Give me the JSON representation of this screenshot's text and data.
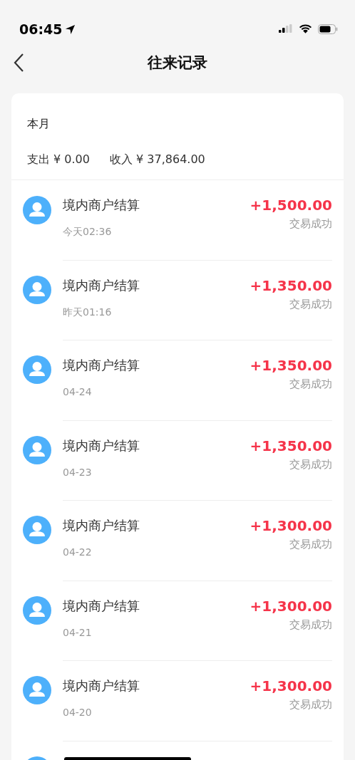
{
  "status_bar": {
    "time": "06:45"
  },
  "nav": {
    "title": "往来记录"
  },
  "summary": {
    "period": "本月",
    "expense": "支出 ¥ 0.00",
    "income": "收入 ¥ 37,864.00"
  },
  "records": [
    {
      "title": "境内商户结算",
      "time": "今天02:36",
      "amount": "+1,500.00",
      "status": "交易成功"
    },
    {
      "title": "境内商户结算",
      "time": "昨天01:16",
      "amount": "+1,350.00",
      "status": "交易成功"
    },
    {
      "title": "境内商户结算",
      "time": "04-24",
      "amount": "+1,350.00",
      "status": "交易成功"
    },
    {
      "title": "境内商户结算",
      "time": "04-23",
      "amount": "+1,350.00",
      "status": "交易成功"
    },
    {
      "title": "境内商户结算",
      "time": "04-22",
      "amount": "+1,300.00",
      "status": "交易成功"
    },
    {
      "title": "境内商户结算",
      "time": "04-21",
      "amount": "+1,300.00",
      "status": "交易成功"
    },
    {
      "title": "境内商户结算",
      "time": "04-20",
      "amount": "+1,300.00",
      "status": "交易成功"
    },
    {
      "kind": "partial"
    }
  ]
}
